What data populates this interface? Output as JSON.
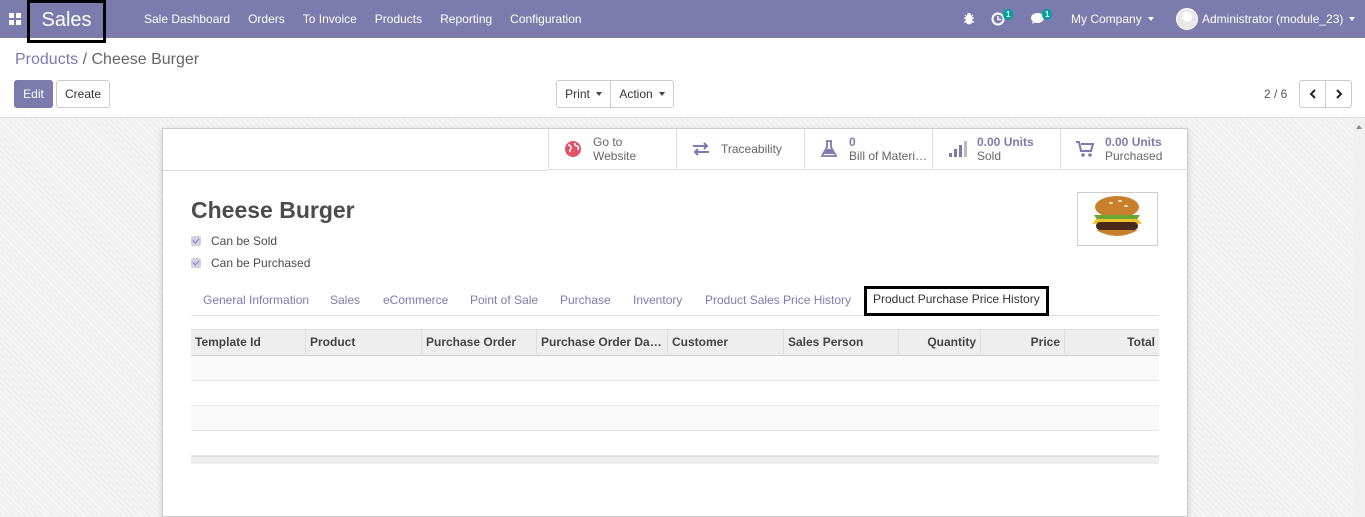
{
  "navbar": {
    "app_name": "Sales",
    "menu": [
      "Sale Dashboard",
      "Orders",
      "To Invoice",
      "Products",
      "Reporting",
      "Configuration"
    ],
    "activity_count": "1",
    "message_count": "1",
    "company": "My Company",
    "user": "Administrator (module_23)"
  },
  "breadcrumb": {
    "parent": "Products",
    "separator": "/",
    "current": "Cheese Burger"
  },
  "buttons": {
    "edit": "Edit",
    "create": "Create",
    "print": "Print",
    "action": "Action"
  },
  "pager": {
    "value": "2 / 6"
  },
  "smart_buttons": {
    "website": {
      "line1": "Go to",
      "line2": "Website"
    },
    "traceability": {
      "label": "Traceability"
    },
    "bom": {
      "value": "0",
      "label": "Bill of Materi…"
    },
    "sold": {
      "value": "0.00 Units",
      "label": "Sold"
    },
    "purchased": {
      "value": "0.00 Units",
      "label": "Purchased"
    }
  },
  "product": {
    "name": "Cheese Burger",
    "can_be_sold": "Can be Sold",
    "can_be_purchased": "Can be Purchased"
  },
  "tabs": [
    "General Information",
    "Sales",
    "eCommerce",
    "Point of Sale",
    "Purchase",
    "Inventory",
    "Product Sales Price History",
    "Product Purchase Price History"
  ],
  "table": {
    "columns": [
      "Template Id",
      "Product",
      "Purchase Order",
      "Purchase Order Dat…",
      "Customer",
      "Sales Person",
      "Quantity",
      "Price",
      "Total"
    ]
  },
  "colors": {
    "brand": "#7c7bad",
    "highlight_border": "#000000"
  }
}
